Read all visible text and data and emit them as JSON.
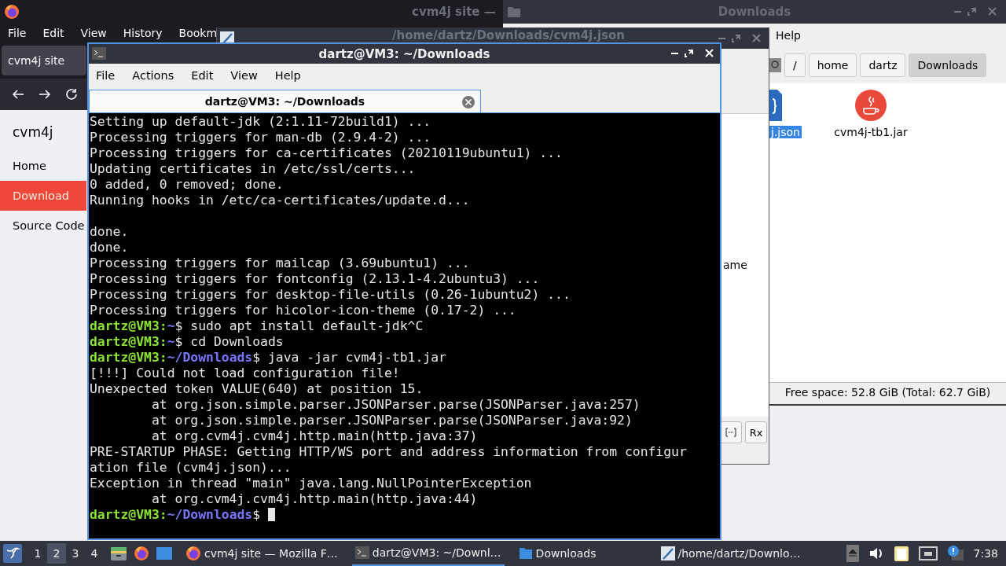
{
  "browser": {
    "title": "cvm4j site —",
    "menu": [
      "File",
      "Edit",
      "View",
      "History",
      "Bookm"
    ],
    "tab": "cvm4j site",
    "site_title": "cvm4j",
    "nav": [
      {
        "label": "Home",
        "selected": false
      },
      {
        "label": "Download",
        "selected": true
      },
      {
        "label": "Source Code",
        "selected": false
      }
    ]
  },
  "file_manager": {
    "title": "Downloads",
    "menu": [
      "Help"
    ],
    "path": [
      {
        "label": "/",
        "selected": false
      },
      {
        "label": "home",
        "selected": false
      },
      {
        "label": "dartz",
        "selected": false
      },
      {
        "label": "Downloads",
        "selected": true
      }
    ],
    "files": [
      {
        "name": "j.json",
        "kind": "json",
        "selected": true
      },
      {
        "name": "cvm4j-tb1.jar",
        "kind": "jar",
        "selected": false
      }
    ],
    "status": "Free space: 52.8 GiB (Total: 62.7 GiB)"
  },
  "editor": {
    "title": "/home/dartz/Downloads/cvm4j.json",
    "column_header": "ame",
    "regex_button": "Rx"
  },
  "terminal": {
    "title": "dartz@VM3: ~/Downloads",
    "menu": [
      "File",
      "Actions",
      "Edit",
      "View",
      "Help"
    ],
    "tab": "dartz@VM3: ~/Downloads",
    "lines": [
      {
        "kind": "output",
        "text": "Setting up default-jdk (2:1.11-72build1) ..."
      },
      {
        "kind": "output",
        "text": "Processing triggers for man-db (2.9.4-2) ..."
      },
      {
        "kind": "output",
        "text": "Processing triggers for ca-certificates (20210119ubuntu1) ..."
      },
      {
        "kind": "output",
        "text": "Updating certificates in /etc/ssl/certs..."
      },
      {
        "kind": "output",
        "text": "0 added, 0 removed; done."
      },
      {
        "kind": "output",
        "text": "Running hooks in /etc/ca-certificates/update.d..."
      },
      {
        "kind": "blank"
      },
      {
        "kind": "output",
        "text": "done."
      },
      {
        "kind": "output",
        "text": "done."
      },
      {
        "kind": "output",
        "text": "Processing triggers for mailcap (3.69ubuntu1) ..."
      },
      {
        "kind": "output",
        "text": "Processing triggers for fontconfig (2.13.1-4.2ubuntu3) ..."
      },
      {
        "kind": "output",
        "text": "Processing triggers for desktop-file-utils (0.26-1ubuntu2) ..."
      },
      {
        "kind": "output",
        "text": "Processing triggers for hicolor-icon-theme (0.17-2) ..."
      },
      {
        "kind": "prompt",
        "user": "dartz@VM3:",
        "path": "~",
        "command": "$ sudo apt install default-jdk^C"
      },
      {
        "kind": "prompt",
        "user": "dartz@VM3:",
        "path": "~",
        "command": "$ cd Downloads"
      },
      {
        "kind": "prompt",
        "user": "dartz@VM3:",
        "path": "~/Downloads",
        "command": "$ java -jar cvm4j-tb1.jar"
      },
      {
        "kind": "output",
        "text": "[!!!] Could not load configuration file!"
      },
      {
        "kind": "output",
        "text": "Unexpected token VALUE(640) at position 15."
      },
      {
        "kind": "output",
        "text": "        at org.json.simple.parser.JSONParser.parse(JSONParser.java:257)"
      },
      {
        "kind": "output",
        "text": "        at org.json.simple.parser.JSONParser.parse(JSONParser.java:92)"
      },
      {
        "kind": "output",
        "text": "        at org.cvm4j.cvm4j.http.main(http.java:37)"
      },
      {
        "kind": "output",
        "text": "PRE-STARTUP PHASE: Getting HTTP/WS port and address information from configur"
      },
      {
        "kind": "output",
        "text": "ation file (cvm4j.json)..."
      },
      {
        "kind": "output",
        "text": "Exception in thread \"main\" java.lang.NullPointerException"
      },
      {
        "kind": "output",
        "text": "        at org.cvm4j.cvm4j.http.main(http.java:44)"
      },
      {
        "kind": "prompt",
        "user": "dartz@VM3:",
        "path": "~/Downloads",
        "command": "$ ",
        "cursor": true
      }
    ]
  },
  "taskbar": {
    "workspaces": [
      {
        "label": "1",
        "selected": false
      },
      {
        "label": "2",
        "selected": true
      },
      {
        "label": "3",
        "selected": false
      },
      {
        "label": "4",
        "selected": false
      }
    ],
    "tasks": [
      {
        "label": "cvm4j site — Mozilla F…",
        "kind": "browser",
        "selected": false
      },
      {
        "label": "dartz@VM3: ~/Downl…",
        "kind": "terminal",
        "selected": true
      },
      {
        "label": "Downloads",
        "kind": "folder",
        "selected": false
      },
      {
        "label": "/home/dartz/Downlo…",
        "kind": "editor",
        "selected": false
      }
    ],
    "clock": "7:38"
  }
}
